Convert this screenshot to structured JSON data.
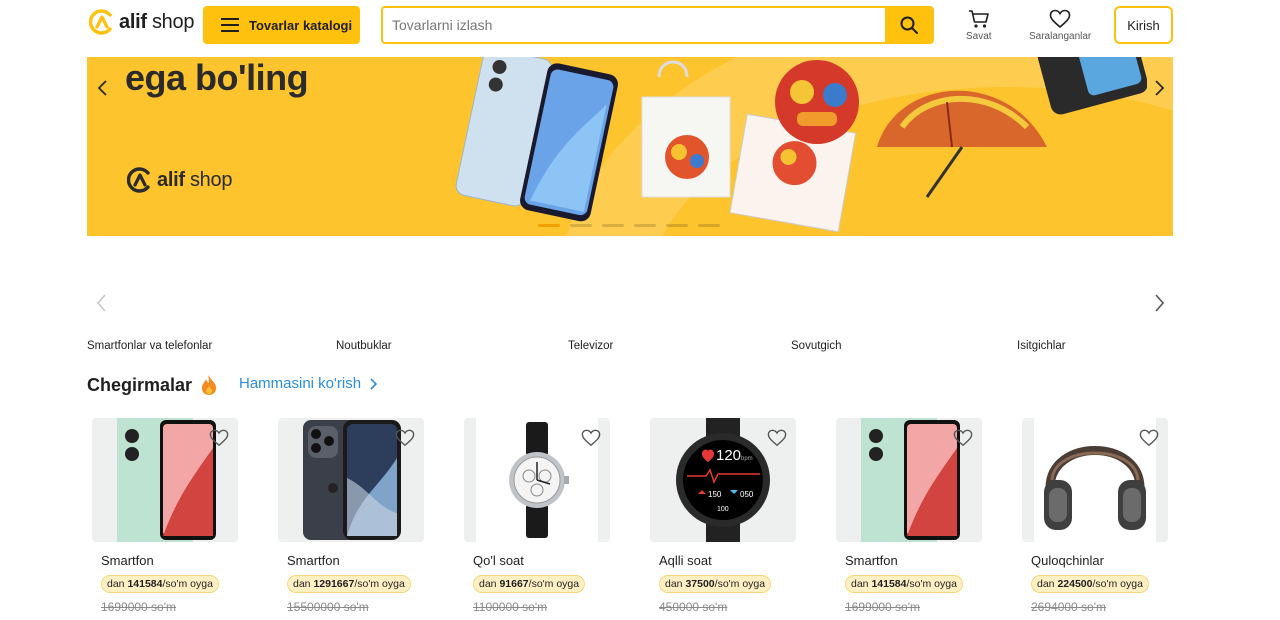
{
  "header": {
    "logo_word": "alif",
    "logo_word2": "shop",
    "catalog_label": "Tovarlar katalogi",
    "search_placeholder": "Tovarlarni izlash",
    "cart_label": "Savat",
    "favorites_label": "Saralanganlar",
    "login_label": "Kirish",
    "accent_color": "#fec10e"
  },
  "banner": {
    "title": "ega bo'ling",
    "logo_word": "alif",
    "logo_word2": "shop",
    "slide_count": 6,
    "active_slide": 1
  },
  "categories": [
    "Smartfonlar va telefonlar",
    "Noutbuklar",
    "Televizor",
    "Sovutgich",
    "Isitgichlar"
  ],
  "discounts": {
    "title": "Chegirmalar",
    "see_all": "Hammasini ko'rish"
  },
  "products": [
    {
      "name": "Smartfon",
      "prefix": "dan",
      "price": "141584",
      "suffix": "/so'm oyga",
      "old_price": "1699000 so'm",
      "image": "green-phone"
    },
    {
      "name": "Smartfon",
      "prefix": "dan",
      "price": "1291667",
      "suffix": "/so'm oyga",
      "old_price": "15500000 so'm",
      "image": "iphone"
    },
    {
      "name": "Qo'l soat",
      "prefix": "dan",
      "price": "91667",
      "suffix": "/so'm oyga",
      "old_price": "1100000 so'm",
      "image": "wrist-watch"
    },
    {
      "name": "Aqlli soat",
      "prefix": "dan",
      "price": "37500",
      "suffix": "/so'm oyga",
      "old_price": "450000 so'm",
      "image": "smart-watch"
    },
    {
      "name": "Smartfon",
      "prefix": "dan",
      "price": "141584",
      "suffix": "/so'm oyga",
      "old_price": "1699000 so'm",
      "image": "green-phone"
    },
    {
      "name": "Quloqchinlar",
      "prefix": "dan",
      "price": "224500",
      "suffix": "/so'm oyga",
      "old_price": "2694000 so'm",
      "image": "headphones"
    }
  ],
  "smartwatch_screen": {
    "bpm": "120",
    "bpm_unit": "bpm",
    "left": "150",
    "right": "050",
    "bottom": "100"
  }
}
